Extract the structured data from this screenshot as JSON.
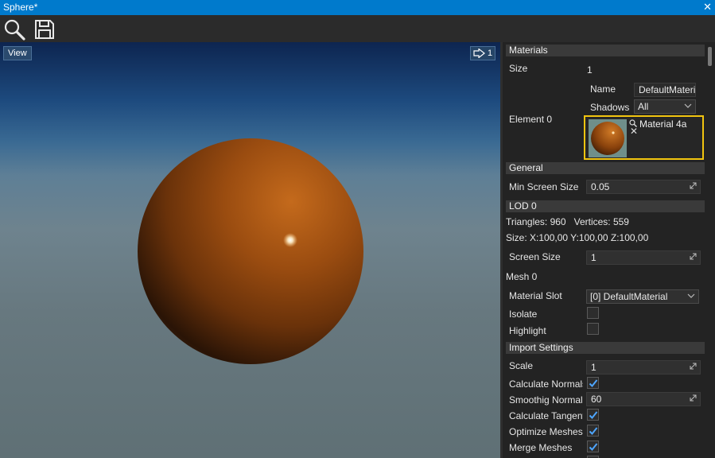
{
  "window": {
    "title": "Sphere*"
  },
  "toolbar": {
    "search_tooltip": "Search",
    "save_tooltip": "Save"
  },
  "viewport": {
    "view_label": "View",
    "camera_speed": "1"
  },
  "colors": {
    "accent": "#007acc",
    "highlight": "#f1c40f",
    "check": "#4ea6ff"
  },
  "materials": {
    "section_label": "Materials",
    "size_label": "Size",
    "size_value": "1",
    "element_label": "Element 0",
    "name_label": "Name",
    "name_value": "DefaultMateri",
    "shadows_label": "Shadows",
    "shadows_value": "All",
    "material_name": "Material 4a"
  },
  "general": {
    "section_label": "General",
    "min_screen_size_label": "Min Screen Size",
    "min_screen_size_value": "0.05"
  },
  "lod": {
    "section_label": "LOD 0",
    "stats_line": "Triangles: 960   Vertices: 559",
    "size_line": "Size: X:100,00 Y:100,00 Z:100,00",
    "screen_size_label": "Screen Size",
    "screen_size_value": "1",
    "mesh_label": "Mesh 0",
    "material_slot_label": "Material Slot",
    "material_slot_value": "[0] DefaultMaterial",
    "isolate_label": "Isolate",
    "highlight_label": "Highlight",
    "isolate_checked": false,
    "highlight_checked": false
  },
  "import_settings": {
    "section_label": "Import Settings",
    "scale_label": "Scale",
    "scale_value": "1",
    "calc_normals_label": "Calculate Normals",
    "calc_normals_checked": true,
    "smoothing_label": "Smoothig Normal",
    "smoothing_value": "60",
    "calc_tangents_label": "Calculate Tangent",
    "calc_tangents_checked": true,
    "optimize_label": "Optimize Meshes",
    "optimize_checked": true,
    "merge_label": "Merge Meshes",
    "merge_checked": true
  }
}
